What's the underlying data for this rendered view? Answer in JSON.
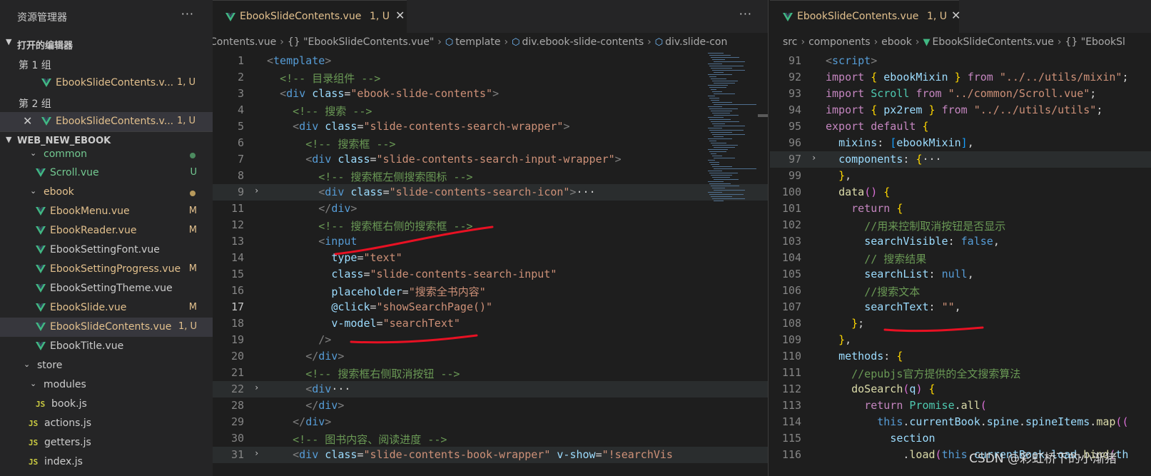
{
  "sidebar": {
    "title": "资源管理器",
    "more": "···",
    "open_editors": {
      "label": "打开的编辑器",
      "groups": [
        {
          "label": "第 1 组",
          "file": "EbookSlideContents.v...",
          "badge": "1, U"
        },
        {
          "label": "第 2 组",
          "file": "EbookSlideContents.v...",
          "badge": "1, U"
        }
      ]
    },
    "project": {
      "label": "WEB_NEW_EBOOK"
    },
    "tree": [
      {
        "name": "common",
        "kind": "folder",
        "badge": "",
        "color": "#73c991"
      },
      {
        "name": "Scroll.vue",
        "kind": "vue",
        "badge": "U",
        "color": "#73c991"
      },
      {
        "name": "ebook",
        "kind": "folder",
        "badge": "",
        "color": "#e2c08d"
      },
      {
        "name": "EbookMenu.vue",
        "kind": "vue",
        "badge": "M",
        "color": "#e2c08d"
      },
      {
        "name": "EbookReader.vue",
        "kind": "vue",
        "badge": "M",
        "color": "#e2c08d"
      },
      {
        "name": "EbookSettingFont.vue",
        "kind": "vue",
        "badge": "",
        "color": "#cccccc"
      },
      {
        "name": "EbookSettingProgress.vue",
        "kind": "vue",
        "badge": "M",
        "color": "#e2c08d"
      },
      {
        "name": "EbookSettingTheme.vue",
        "kind": "vue",
        "badge": "",
        "color": "#cccccc"
      },
      {
        "name": "EbookSlide.vue",
        "kind": "vue",
        "badge": "M",
        "color": "#e2c08d"
      },
      {
        "name": "EbookSlideContents.vue",
        "kind": "vue",
        "badge": "1, U",
        "color": "#e2c08d"
      },
      {
        "name": "EbookTitle.vue",
        "kind": "vue",
        "badge": "",
        "color": "#cccccc"
      },
      {
        "name": "store",
        "kind": "folder",
        "badge": "",
        "color": "#cccccc"
      },
      {
        "name": "modules",
        "kind": "folder",
        "badge": "",
        "color": "#cccccc"
      },
      {
        "name": "book.js",
        "kind": "js",
        "badge": "",
        "color": "#cccccc"
      },
      {
        "name": "actions.js",
        "kind": "js",
        "badge": "",
        "color": "#cccccc"
      },
      {
        "name": "getters.js",
        "kind": "js",
        "badge": "",
        "color": "#cccccc"
      },
      {
        "name": "index.js",
        "kind": "js",
        "badge": "",
        "color": "#cccccc"
      }
    ]
  },
  "left_editor": {
    "tab": {
      "name": "EbookSlideContents.vue",
      "badge": "1, U"
    },
    "more": "···",
    "breadcrumb": [
      "Contents.vue",
      "{} \"EbookSlideContents.vue\"",
      "template",
      "div.ebook-slide-contents",
      "div.slide-con"
    ],
    "lines": [
      {
        "n": "1",
        "text": "<template>"
      },
      {
        "n": "2",
        "text": "  <!-- 目录组件 -->"
      },
      {
        "n": "3",
        "text": "  <div class=\"ebook-slide-contents\">"
      },
      {
        "n": "4",
        "text": "    <!-- 搜索 -->"
      },
      {
        "n": "5",
        "text": "    <div class=\"slide-contents-search-wrapper\">"
      },
      {
        "n": "6",
        "text": "      <!-- 搜索框 -->"
      },
      {
        "n": "7",
        "text": "      <div class=\"slide-contents-search-input-wrapper\">"
      },
      {
        "n": "8",
        "text": "        <!-- 搜索框左侧搜索图标 -->"
      },
      {
        "n": "9",
        "text": "        <div class=\"slide-contents-search-icon\">···"
      },
      {
        "n": "11",
        "text": "        </div>"
      },
      {
        "n": "12",
        "text": "        <!-- 搜索框右侧的搜索框 -->"
      },
      {
        "n": "13",
        "text": "        <input"
      },
      {
        "n": "14",
        "text": "          type=\"text\""
      },
      {
        "n": "15",
        "text": "          class=\"slide-contents-search-input\""
      },
      {
        "n": "16",
        "text": "          placeholder=\"搜索全书内容\""
      },
      {
        "n": "17",
        "text": "          @click=\"showSearchPage()\""
      },
      {
        "n": "18",
        "text": "          v-model=\"searchText\""
      },
      {
        "n": "19",
        "text": "        />"
      },
      {
        "n": "20",
        "text": "      </div>"
      },
      {
        "n": "21",
        "text": "      <!-- 搜索框右侧取消按钮 -->"
      },
      {
        "n": "22",
        "text": "      <div···"
      },
      {
        "n": "28",
        "text": "      </div>"
      },
      {
        "n": "29",
        "text": "    </div>"
      },
      {
        "n": "30",
        "text": "    <!-- 图书内容、阅读进度 -->"
      },
      {
        "n": "31",
        "text": "    <div class=\"slide-contents-book-wrapper\" v-show=\"!searchVis"
      }
    ]
  },
  "right_editor": {
    "tab": {
      "name": "EbookSlideContents.vue",
      "badge": "1, U"
    },
    "breadcrumb": [
      "src",
      "components",
      "ebook",
      "EbookSlideContents.vue",
      "{} \"EbookSl"
    ],
    "lines": [
      {
        "n": "91",
        "text": "<script>"
      },
      {
        "n": "92",
        "text": "import { ebookMixin } from \"../../utils/mixin\";"
      },
      {
        "n": "93",
        "text": "import Scroll from \"../common/Scroll.vue\";"
      },
      {
        "n": "94",
        "text": "import { px2rem } from \"../../utils/utils\";"
      },
      {
        "n": "95",
        "text": "export default {"
      },
      {
        "n": "96",
        "text": "  mixins: [ebookMixin],"
      },
      {
        "n": "97",
        "text": "  components: {···"
      },
      {
        "n": "99",
        "text": "  },"
      },
      {
        "n": "100",
        "text": "  data() {"
      },
      {
        "n": "101",
        "text": "    return {"
      },
      {
        "n": "102",
        "text": "      //用来控制取消按钮是否显示"
      },
      {
        "n": "103",
        "text": "      searchVisible: false,"
      },
      {
        "n": "104",
        "text": "      // 搜索结果"
      },
      {
        "n": "105",
        "text": "      searchList: null,"
      },
      {
        "n": "106",
        "text": "      //搜索文本"
      },
      {
        "n": "107",
        "text": "      searchText: \"\","
      },
      {
        "n": "108",
        "text": "    };"
      },
      {
        "n": "109",
        "text": "  },"
      },
      {
        "n": "110",
        "text": "  methods: {"
      },
      {
        "n": "111",
        "text": "    //epubjs官方提供的全文搜索算法"
      },
      {
        "n": "112",
        "text": "    doSearch(q) {"
      },
      {
        "n": "113",
        "text": "      return Promise.all("
      },
      {
        "n": "114",
        "text": "        this.currentBook.spine.spineItems.map(("
      },
      {
        "n": "115",
        "text": "          section"
      },
      {
        "n": "116",
        "text": "            .load(this.currentBook.load.bind(th"
      }
    ]
  },
  "watermark": "CSDN @彩虹桥下的小渐猪",
  "colors": {
    "accent_modified": "#e2c08d",
    "accent_untracked": "#73c991",
    "vue_green": "#41b883"
  }
}
